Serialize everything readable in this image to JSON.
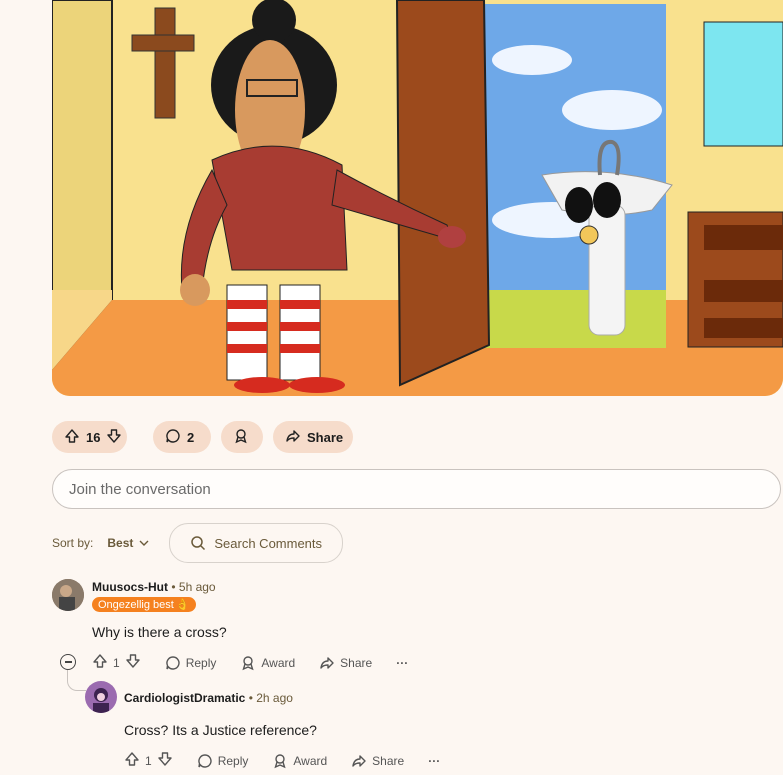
{
  "post": {
    "votes": "16",
    "comments": "2",
    "share_label": "Share"
  },
  "composer": {
    "placeholder": "Join the conversation"
  },
  "sort": {
    "label": "Sort by:",
    "value": "Best",
    "search_placeholder": "Search Comments"
  },
  "comments": [
    {
      "author": "Muusocs-Hut",
      "time": "5h ago",
      "flair": "Ongezellig best",
      "flair_emoji": "👌",
      "text": "Why is there a cross?",
      "votes": "1",
      "reply": "Reply",
      "award": "Award",
      "share": "Share",
      "more": "···"
    },
    {
      "author": "CardiologistDramatic",
      "time": "2h ago",
      "text": "Cross? Its a Justice reference?",
      "votes": "1",
      "reply": "Reply",
      "award": "Award",
      "share": "Share",
      "more": "···"
    }
  ],
  "colors": {
    "background": "#fdf7f2",
    "pill": "#f6dccb",
    "flair": "#f5811f"
  }
}
